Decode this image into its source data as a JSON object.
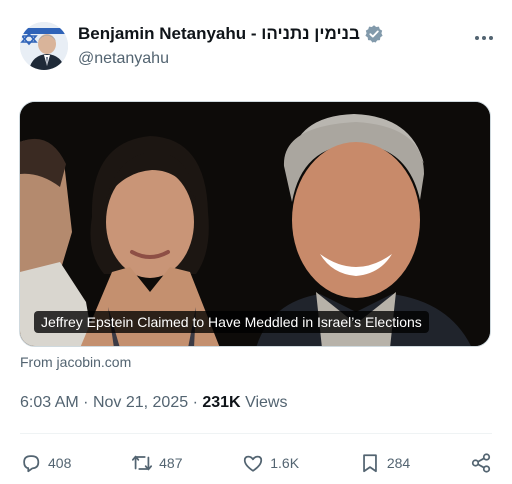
{
  "author": {
    "display_name": "Benjamin Netanyahu - בנימין נתניהו",
    "handle": "@netanyahu",
    "verified_badge_color": "#829aab"
  },
  "card": {
    "caption": "Jeffrey Epstein Claimed to Have Meddled in Israel’s Elections",
    "source": "From jacobin.com"
  },
  "meta": {
    "time": "6:03 AM",
    "separator": "·",
    "date": "Nov 21, 2025",
    "views_count": "231K",
    "views_label": "Views"
  },
  "actions": {
    "replies": "408",
    "reposts": "487",
    "likes": "1.6K",
    "bookmarks": "284"
  },
  "icons": [
    "verified-badge-icon",
    "more-icon",
    "reply-icon",
    "repost-icon",
    "like-icon",
    "bookmark-icon",
    "share-icon"
  ],
  "colors": {
    "text": "#0f1419",
    "secondary": "#536471"
  }
}
